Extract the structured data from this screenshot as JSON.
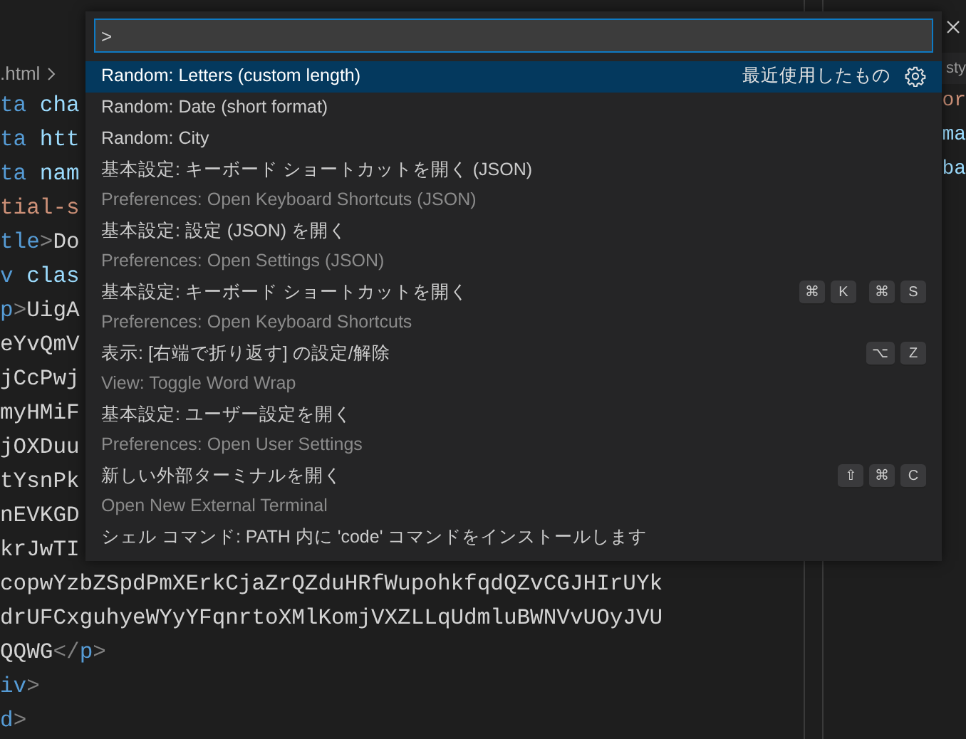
{
  "editor": {
    "breadcrumb": ".html",
    "lines": [
      [
        {
          "kind": "tag",
          "text": "ta"
        },
        {
          "kind": "attr",
          "text": " cha"
        }
      ],
      [
        {
          "kind": "tag",
          "text": "ta"
        },
        {
          "kind": "attr",
          "text": " htt"
        }
      ],
      [
        {
          "kind": "tag",
          "text": "ta"
        },
        {
          "kind": "attr",
          "text": " nam"
        }
      ],
      [
        {
          "kind": "string",
          "text": "tial-s"
        }
      ],
      [
        {
          "kind": "tag",
          "text": "tle"
        },
        {
          "kind": "punct",
          "text": ">"
        },
        {
          "kind": "text",
          "text": "Do"
        }
      ],
      [
        {
          "kind": "tag",
          "text": "v"
        },
        {
          "kind": "attr",
          "text": " clas"
        }
      ],
      [
        {
          "kind": "tag",
          "text": "p"
        },
        {
          "kind": "punct",
          "text": ">"
        },
        {
          "kind": "text",
          "text": "UigA"
        }
      ],
      [
        {
          "kind": "text",
          "text": "eYvQmV"
        }
      ],
      [
        {
          "kind": "text",
          "text": "jCcPwj"
        }
      ],
      [
        {
          "kind": "text",
          "text": "myHMiF"
        }
      ],
      [
        {
          "kind": "text",
          "text": "jOXDuu"
        }
      ],
      [
        {
          "kind": "text",
          "text": "tYsnPk"
        }
      ],
      [
        {
          "kind": "text",
          "text": "nEVKGD"
        }
      ],
      [
        {
          "kind": "text",
          "text": "krJwTI"
        }
      ],
      [
        {
          "kind": "text",
          "text": "copwYzbZSpdPmXErkCjaZrQZduHRfWupohkfqdQZvCGJHIrUYk"
        }
      ],
      [
        {
          "kind": "text",
          "text": "drUFCxguhyeWYyYFqnrtoXMlKomjVXZLLqUdmluBWNVvUOyJVU"
        }
      ],
      [
        {
          "kind": "text",
          "text": "QQWG"
        },
        {
          "kind": "punct",
          "text": "</"
        },
        {
          "kind": "tag",
          "text": "p"
        },
        {
          "kind": "punct",
          "text": ">"
        }
      ],
      [
        {
          "kind": "tag",
          "text": "iv"
        },
        {
          "kind": "punct",
          "text": ">"
        }
      ],
      [
        {
          "kind": "tag",
          "text": "d"
        },
        {
          "kind": "punct",
          "text": ">"
        }
      ]
    ]
  },
  "side": {
    "tab": "sty",
    "lines": [
      {
        "kind": "string",
        "text": "or"
      },
      {
        "kind": "attr",
        "text": "ma"
      },
      {
        "kind": "attr",
        "text": "ba"
      }
    ]
  },
  "palette": {
    "input": {
      "value": ">"
    },
    "items": [
      {
        "label": "Random: Letters (custom length)",
        "selected": true,
        "tag": "最近使用したもの"
      },
      {
        "label": "Random: Date (short format)",
        "selected": false
      },
      {
        "label": "Random: City",
        "selected": false
      },
      {
        "label": "基本設定: キーボード ショートカットを開く (JSON)",
        "detail": "Preferences: Open Keyboard Shortcuts (JSON)",
        "selected": false
      },
      {
        "label": "基本設定: 設定 (JSON) を開く",
        "detail": "Preferences: Open Settings (JSON)",
        "selected": false
      },
      {
        "label": "基本設定: キーボード ショートカットを開く",
        "detail": "Preferences: Open Keyboard Shortcuts",
        "selected": false,
        "keys": [
          [
            "⌘",
            "K"
          ],
          [
            "⌘",
            "S"
          ]
        ]
      },
      {
        "label": "表示: [右端で折り返す] の設定/解除",
        "detail": "View: Toggle Word Wrap",
        "selected": false,
        "keys": [
          [
            "⌥",
            "Z"
          ]
        ]
      },
      {
        "label": "基本設定: ユーザー設定を開く",
        "detail": "Preferences: Open User Settings",
        "selected": false
      },
      {
        "label": "新しい外部ターミナルを開く",
        "detail": "Open New External Terminal",
        "selected": false,
        "keys": [
          [
            "⇧",
            "⌘",
            "C"
          ]
        ]
      },
      {
        "label": "シェル コマンド: PATH 内に 'code' コマンドをインストールします",
        "selected": false
      }
    ]
  }
}
